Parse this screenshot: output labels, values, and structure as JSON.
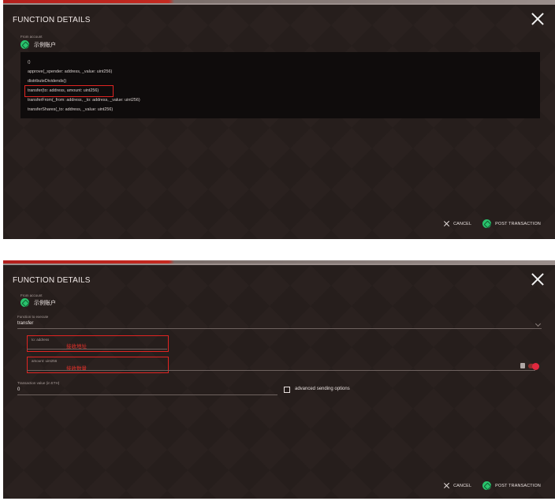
{
  "top": {
    "title": "FUNCTION DETAILS",
    "from_label": "From account",
    "account_name": "示例账户",
    "functions": [
      "()",
      "approve(_spender: address, _value: uint256)",
      "distributeDividends()",
      "transfer(to: address, amount: uint256)",
      "transferFrom(_from: address, _to: address, _value: uint256)",
      "transferShares(_to: address, _value: uint256)"
    ],
    "highlighted_function": "transfer(to: address, amount: uint256)",
    "cancel_label": "CANCEL",
    "post_label": "POST TRANSACTION"
  },
  "bottom": {
    "title": "FUNCTION DETAILS",
    "from_label": "From account",
    "account_name": "示例账户",
    "function_label": "Function to execute",
    "function_value": "transfer",
    "to_label": "to: address",
    "to_annotation": "接收地址",
    "amount_label": "amount: uint256",
    "amount_annotation": "接收数量",
    "eth_label": "Transaction value (in ETH)",
    "eth_value": "0",
    "advanced_label": "advanced sending options",
    "cancel_label": "CANCEL",
    "post_label": "POST TRANSACTION"
  },
  "colors": {
    "background": "#2a211f",
    "highlight": "#e02422",
    "accent_green": "#29c46d",
    "toggle_red": "#e0283e"
  }
}
